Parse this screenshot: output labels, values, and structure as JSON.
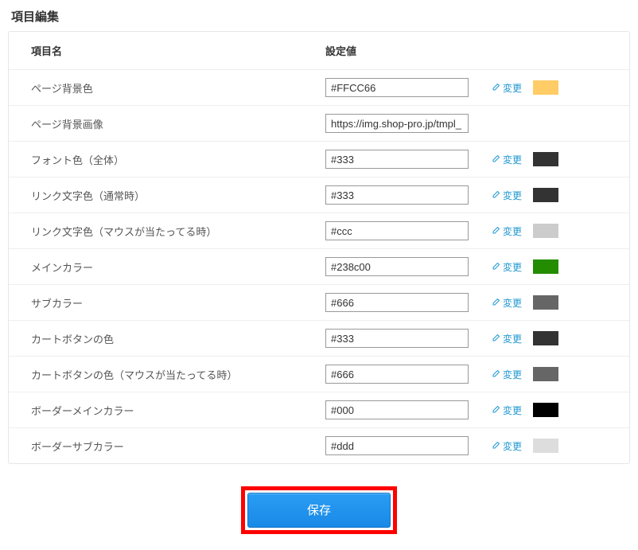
{
  "title": "項目編集",
  "headers": {
    "name": "項目名",
    "value": "設定値"
  },
  "change_label": "変更",
  "save_label": "保存",
  "rows": [
    {
      "label": "ページ背景色",
      "value": "#FFCC66",
      "swatch": "#FFCC66",
      "has_change": true
    },
    {
      "label": "ページ背景画像",
      "value": "https://img.shop-pro.jp/tmpl_",
      "swatch": null,
      "has_change": false
    },
    {
      "label": "フォント色（全体）",
      "value": "#333",
      "swatch": "#333333",
      "has_change": true
    },
    {
      "label": "リンク文字色（通常時）",
      "value": "#333",
      "swatch": "#333333",
      "has_change": true
    },
    {
      "label": "リンク文字色（マウスが当たってる時）",
      "value": "#ccc",
      "swatch": "#cccccc",
      "has_change": true
    },
    {
      "label": "メインカラー",
      "value": "#238c00",
      "swatch": "#238c00",
      "has_change": true
    },
    {
      "label": "サブカラー",
      "value": "#666",
      "swatch": "#666666",
      "has_change": true
    },
    {
      "label": "カートボタンの色",
      "value": "#333",
      "swatch": "#333333",
      "has_change": true
    },
    {
      "label": "カートボタンの色（マウスが当たってる時）",
      "value": "#666",
      "swatch": "#666666",
      "has_change": true
    },
    {
      "label": "ボーダーメインカラー",
      "value": "#000",
      "swatch": "#000000",
      "has_change": true
    },
    {
      "label": "ボーダーサブカラー",
      "value": "#ddd",
      "swatch": "#dddddd",
      "has_change": true
    }
  ]
}
